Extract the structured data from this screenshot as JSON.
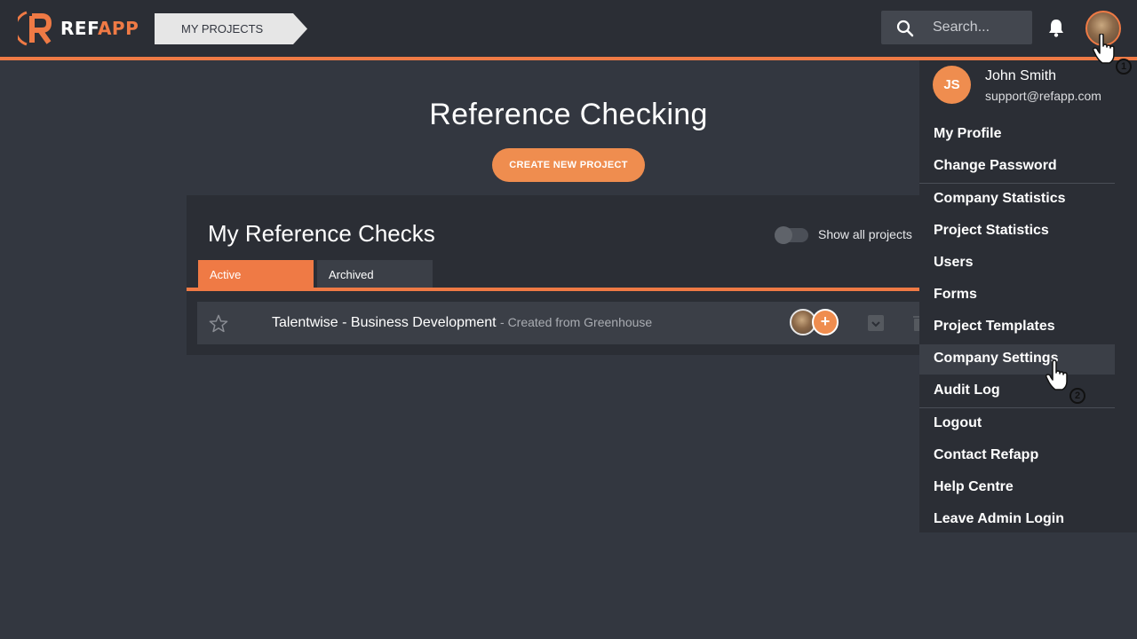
{
  "app": {
    "logo_ref": "REF",
    "logo_app": "APP",
    "breadcrumb": "MY PROJECTS",
    "search_placeholder": "Search..."
  },
  "main": {
    "heading": "Reference Checking",
    "create_button": "CREATE NEW PROJECT",
    "panel_title": "My Reference Checks",
    "toggle_label": "Show all projects",
    "toggle_on": false,
    "tabs": [
      {
        "label": "Active",
        "active": true
      },
      {
        "label": "Archived",
        "active": false
      }
    ],
    "projects": [
      {
        "title": "Talentwise - Business Development",
        "subtitle": "- Created from Greenhouse"
      }
    ]
  },
  "user_menu": {
    "initials": "JS",
    "name": "John Smith",
    "email": "support@refapp.com",
    "items": [
      "My Profile",
      "Change Password",
      "Company Statistics",
      "Project Statistics",
      "Users",
      "Forms",
      "Project Templates",
      "Company Settings",
      "Audit Log",
      "Logout",
      "Contact Refapp",
      "Help Centre",
      "Leave Admin Login"
    ],
    "highlighted": "Company Settings"
  },
  "annotations": {
    "step1": "1",
    "step2": "2"
  },
  "colors": {
    "accent": "#ef7a45",
    "button": "#ef8d4f",
    "background": "#333740",
    "bar": "#2b2e35"
  }
}
